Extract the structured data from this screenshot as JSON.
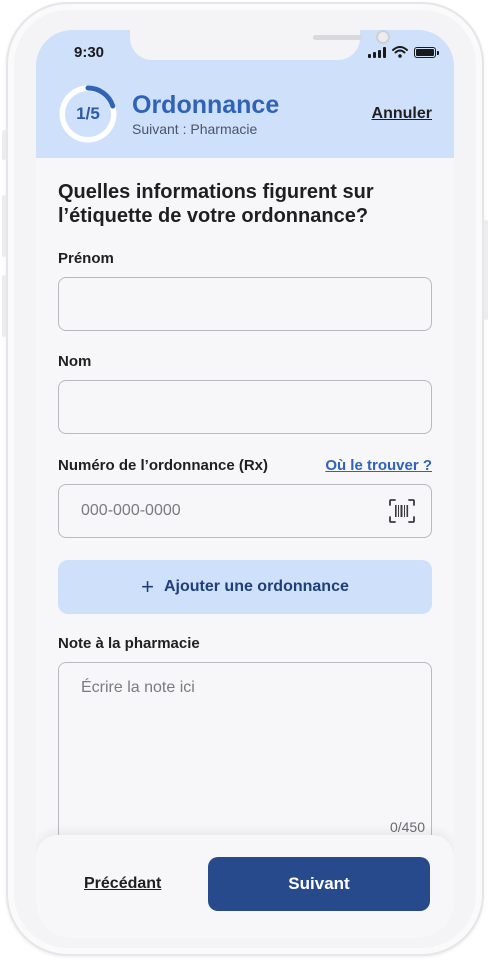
{
  "status_bar": {
    "time": "9:30"
  },
  "header": {
    "step_label": "1/5",
    "step_progress": 0.2,
    "title": "Ordonnance",
    "subtitle": "Suivant : Pharmacie",
    "cancel_label": "Annuler"
  },
  "form": {
    "question": "Quelles informations figurent sur l’étiquette de votre ordonnance?",
    "first_name": {
      "label": "Prénom",
      "value": "",
      "placeholder": ""
    },
    "last_name": {
      "label": "Nom",
      "value": "",
      "placeholder": ""
    },
    "rx_number": {
      "label": "Numéro de l’ordonnance (Rx)",
      "help_link": "Où le trouver ?",
      "placeholder": "000-000-0000",
      "value": ""
    },
    "add_prescription_label": "Ajouter une ordonnance",
    "note": {
      "label": "Note à la pharmacie",
      "placeholder": "Écrire la note ici",
      "counter": "0/450"
    }
  },
  "footer": {
    "previous_label": "Précédant",
    "next_label": "Suivant"
  },
  "colors": {
    "accent": "#2f63b8",
    "header_bg": "#cfe0fb",
    "primary_button": "#264a8c"
  },
  "icons": {
    "add": "plus-icon",
    "scan": "barcode-scan-icon",
    "wifi": "wifi-icon",
    "signal": "signal-icon",
    "battery": "battery-icon"
  }
}
